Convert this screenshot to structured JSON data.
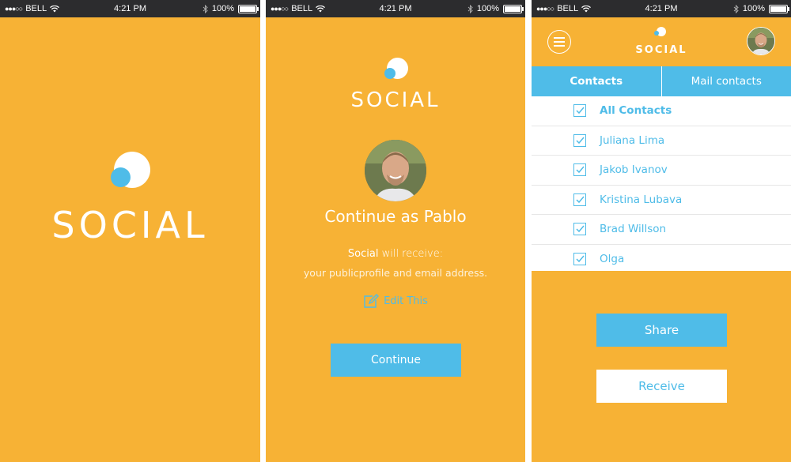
{
  "statusbar": {
    "carrier": "BELL",
    "time": "4:21 PM",
    "battery": "100%",
    "battery_level": 1.0
  },
  "app": {
    "name": "SOCIAL"
  },
  "login": {
    "heading": "Continue as Pablo",
    "app_name": "Social",
    "receive_text": " will receive:",
    "receive_sub": "your publicprofile and email address.",
    "edit_label": "Edit This",
    "continue_label": "Continue"
  },
  "contacts_screen": {
    "tabs": [
      {
        "label": "Contacts",
        "active": true
      },
      {
        "label": "Mail contacts",
        "active": false
      }
    ],
    "items": [
      {
        "label": "All Contacts",
        "checked": true
      },
      {
        "label": "Juliana Lima",
        "checked": true
      },
      {
        "label": "Jakob Ivanov",
        "checked": true
      },
      {
        "label": "Kristina Lubava",
        "checked": true
      },
      {
        "label": "Brad Willson",
        "checked": true
      },
      {
        "label": "Olga",
        "checked": true
      }
    ],
    "share_label": "Share",
    "receive_label": "Receive"
  },
  "colors": {
    "background": "#f7b235",
    "accent": "#4fbce8",
    "statusbar": "#2c2c2e"
  },
  "icons": [
    "signal-dots-icon",
    "wifi-icon",
    "bluetooth-icon",
    "battery-icon",
    "menu-icon",
    "edit-icon",
    "checkbox-icon",
    "logo-icon"
  ]
}
